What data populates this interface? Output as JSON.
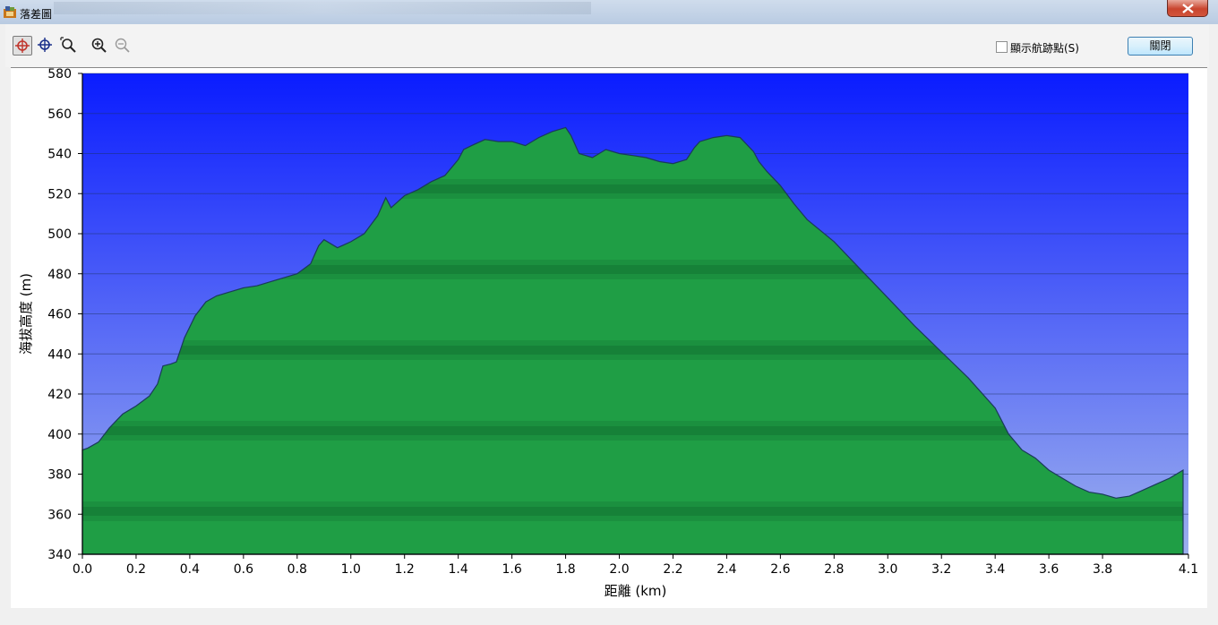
{
  "window": {
    "title": "落差圖"
  },
  "toolbar": {
    "tools": [
      {
        "name": "crosshair-select-tool",
        "icon": "crosshair-icon",
        "active": true
      },
      {
        "name": "crosshair-move-tool",
        "icon": "crosshair-icon",
        "active": false
      },
      {
        "name": "zoom-area-tool",
        "icon": "zoom-area-icon",
        "active": false
      },
      {
        "name": "zoom-in-tool",
        "icon": "zoom-in-icon",
        "active": false
      },
      {
        "name": "zoom-out-tool",
        "icon": "zoom-out-icon",
        "active": false
      }
    ],
    "show_waypoints_label": "顯示航跡點(S)",
    "show_waypoints_checked": false,
    "close_label": "關閉"
  },
  "chart_data": {
    "type": "area",
    "xlabel": "距離 (km)",
    "ylabel": "海拔高度 (m)",
    "xlim": [
      0.0,
      4.12
    ],
    "ylim": [
      340,
      580
    ],
    "x_ticks": [
      "0.0",
      "0.2",
      "0.4",
      "0.6",
      "0.8",
      "1.0",
      "1.2",
      "1.4",
      "1.6",
      "1.8",
      "2.0",
      "2.2",
      "2.4",
      "2.6",
      "2.8",
      "3.0",
      "3.2",
      "3.4",
      "3.6",
      "3.8",
      "4.1"
    ],
    "y_ticks": [
      "340",
      "360",
      "380",
      "400",
      "420",
      "440",
      "460",
      "480",
      "500",
      "520",
      "540",
      "560",
      "580"
    ],
    "grid": true,
    "colors": {
      "sky_top": "#0a1cff",
      "sky_bottom": "#9db0ee",
      "terrain": "#1f9e45",
      "terrain_line": "#1a3a5a"
    },
    "series": [
      {
        "x": [
          0.0,
          0.02,
          0.06,
          0.1,
          0.15,
          0.2,
          0.25,
          0.28,
          0.3,
          0.33,
          0.35,
          0.38,
          0.42,
          0.46,
          0.5,
          0.55,
          0.6,
          0.65,
          0.7,
          0.75,
          0.8,
          0.85,
          0.88,
          0.9,
          0.95,
          1.0,
          1.05,
          1.1,
          1.13,
          1.15,
          1.2,
          1.25,
          1.3,
          1.35,
          1.4,
          1.42,
          1.45,
          1.5,
          1.55,
          1.6,
          1.65,
          1.7,
          1.75,
          1.8,
          1.82,
          1.85,
          1.9,
          1.95,
          2.0,
          2.05,
          2.1,
          2.15,
          2.2,
          2.25,
          2.28,
          2.3,
          2.35,
          2.4,
          2.45,
          2.5,
          2.52,
          2.55,
          2.6,
          2.65,
          2.7,
          2.8,
          2.9,
          3.0,
          3.1,
          3.2,
          3.3,
          3.4,
          3.45,
          3.5,
          3.55,
          3.6,
          3.65,
          3.7,
          3.75,
          3.8,
          3.85,
          3.9,
          3.95,
          4.0,
          4.05,
          4.1
        ],
        "y": [
          392,
          393,
          396,
          403,
          410,
          414,
          419,
          425,
          434,
          435,
          436,
          448,
          459,
          466,
          469,
          471,
          473,
          474,
          476,
          478,
          480,
          485,
          494,
          497,
          493,
          496,
          500,
          509,
          518,
          513,
          519,
          522,
          526,
          529,
          537,
          542,
          544,
          547,
          546,
          546,
          544,
          548,
          551,
          553,
          549,
          540,
          538,
          542,
          540,
          539,
          538,
          536,
          535,
          537,
          543,
          546,
          548,
          549,
          548,
          541,
          536,
          531,
          524,
          515,
          507,
          496,
          482,
          468,
          454,
          441,
          428,
          413,
          400,
          392,
          388,
          382,
          378,
          374,
          371,
          370,
          368,
          369,
          372,
          375,
          378,
          382
        ]
      }
    ]
  }
}
